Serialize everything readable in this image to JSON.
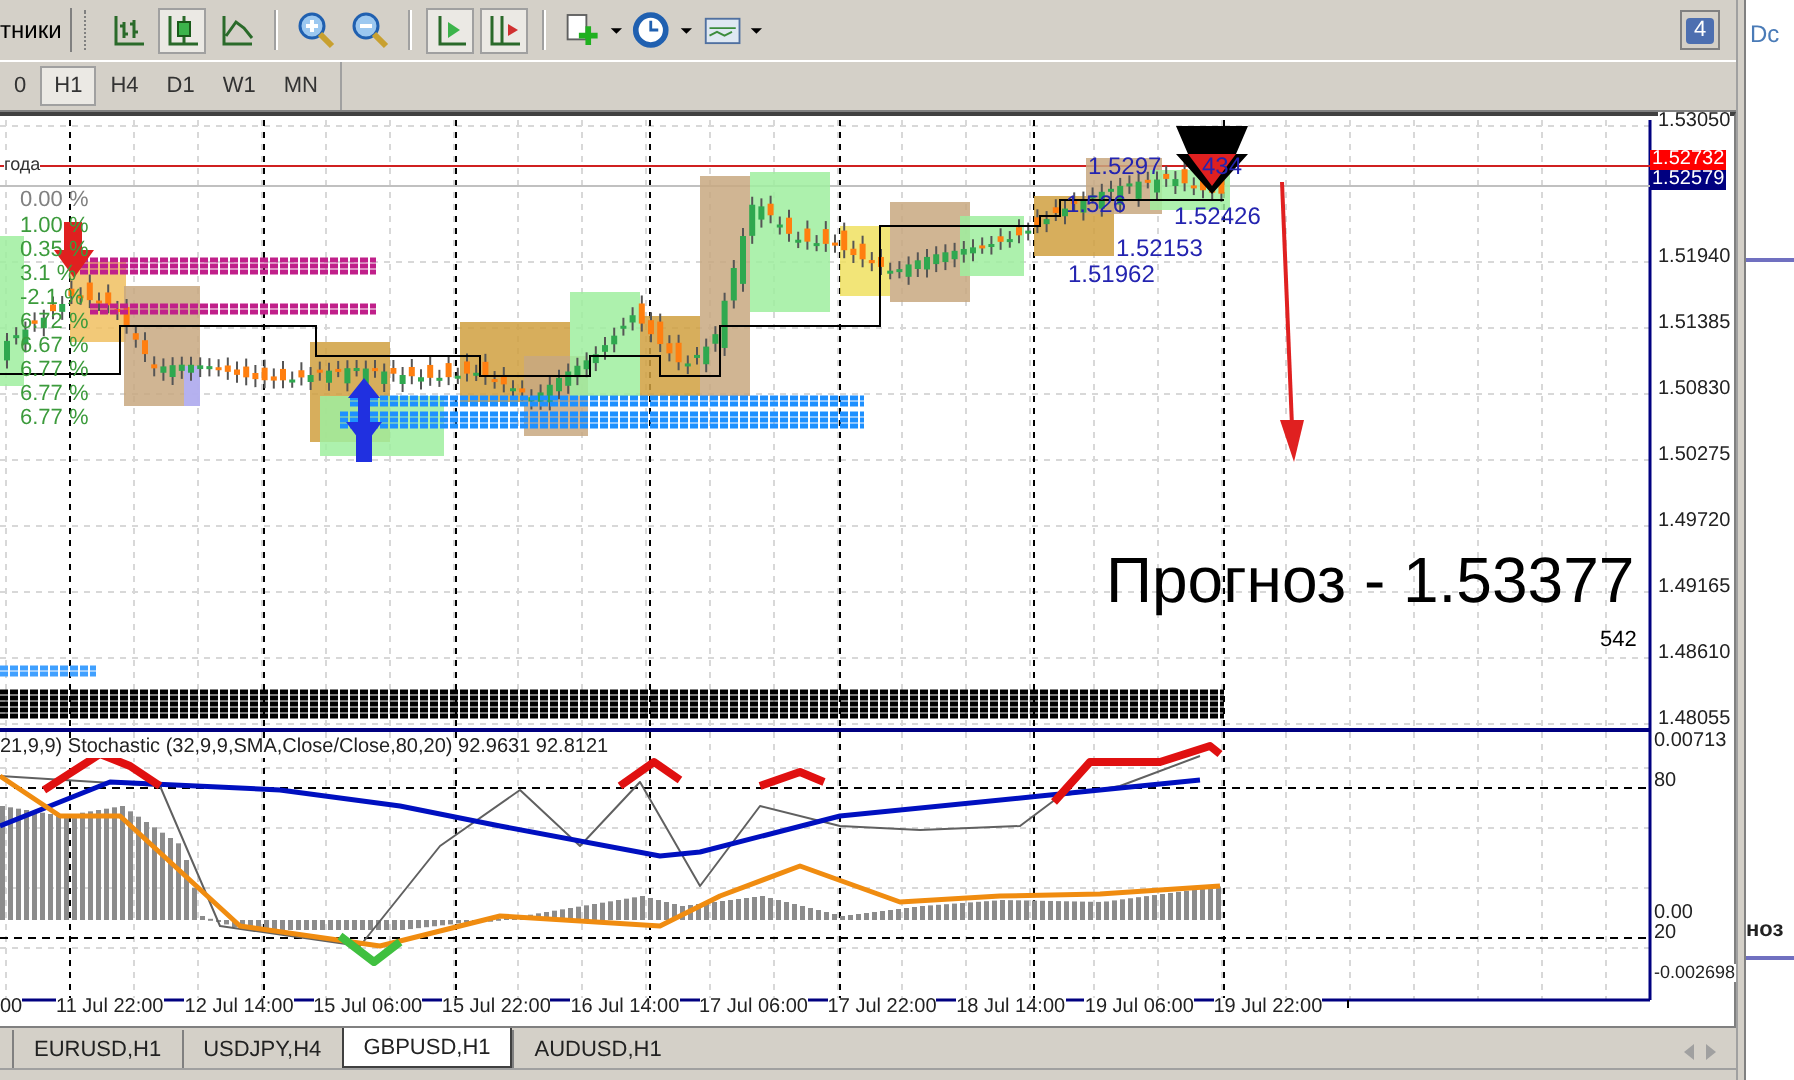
{
  "toolbar": {
    "partial_label": "тники",
    "buttons": [
      {
        "kind": "bars",
        "pressed": false
      },
      {
        "kind": "candles",
        "pressed": true
      },
      {
        "kind": "line",
        "pressed": false
      },
      {
        "kind": "zoom-in",
        "pressed": false
      },
      {
        "kind": "zoom-out",
        "pressed": false
      },
      {
        "kind": "shift",
        "pressed": true
      },
      {
        "kind": "autoscroll",
        "pressed": true
      },
      {
        "kind": "new",
        "pressed": false
      },
      {
        "kind": "clock",
        "pressed": false
      },
      {
        "kind": "template",
        "pressed": false
      }
    ],
    "notification_count": "4"
  },
  "timeframes": [
    {
      "label": "0",
      "selected": false
    },
    {
      "label": "H1",
      "selected": true
    },
    {
      "label": "H4",
      "selected": false
    },
    {
      "label": "D1",
      "selected": false
    },
    {
      "label": "W1",
      "selected": false
    },
    {
      "label": "MN",
      "selected": false
    }
  ],
  "chart": {
    "top_left_label": "года",
    "percent_labels": [
      {
        "text": "0.00 %",
        "color": "#808080"
      },
      {
        "text": "1.00 %",
        "color": "#3c9b3c"
      },
      {
        "text": "0.35 %",
        "color": "#3c9b3c"
      },
      {
        "text": "3.1 %",
        "color": "#3c9b3c"
      },
      {
        "text": "-2.1 %",
        "color": "#3c9b3c"
      },
      {
        "text": "6.72 %",
        "color": "#3c9b3c"
      },
      {
        "text": "6.67 %",
        "color": "#3c9b3c"
      },
      {
        "text": "6.77 %",
        "color": "#3c9b3c"
      },
      {
        "text": "6.77 %",
        "color": "#3c9b3c"
      },
      {
        "text": "6.77 %",
        "color": "#3c9b3c"
      }
    ],
    "level_labels": [
      "1.5297",
      "434",
      "1.526",
      "1.52426",
      "1.52153",
      "1.51962"
    ],
    "forecast": "Прогноз - 1.53377",
    "counter": "542",
    "price_axis": [
      "1.53050",
      "1.51940",
      "1.51385",
      "1.50830",
      "1.50275",
      "1.49720",
      "1.49165",
      "1.48610",
      "1.48055"
    ],
    "price_badges": [
      {
        "text": "1.52732",
        "color": "#ff0000"
      },
      {
        "text": "1.52579",
        "color": "#000080"
      }
    ],
    "indicator_title": "21,9,9)  Stochastic (32,9,9,SMA,Close/Close,80,20) 92.9631 92.8121",
    "indicator_axis": [
      "0.00713",
      "80",
      "0.00",
      "20",
      "-0.002698"
    ],
    "time_axis": [
      "00",
      "11 Jul 22:00",
      "12 Jul 14:00",
      "15 Jul 06:00",
      "15 Jul 22:00",
      "16 Jul 14:00",
      "17 Jul 06:00",
      "17 Jul 22:00",
      "18 Jul 14:00",
      "19 Jul 06:00",
      "19 Jul 22:00"
    ]
  },
  "tabs": [
    {
      "label": "EURUSD,H1",
      "selected": false
    },
    {
      "label": "USDJPY,H4",
      "selected": false
    },
    {
      "label": "GBPUSD,H1",
      "selected": true
    },
    {
      "label": "AUDUSD,H1",
      "selected": false
    }
  ],
  "side_panel": {
    "texts": [
      "Dc",
      "ноз"
    ]
  }
}
